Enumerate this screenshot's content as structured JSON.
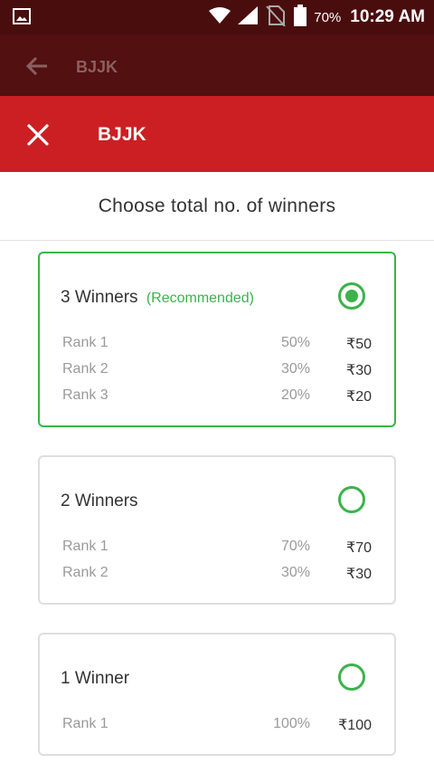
{
  "status_bar": {
    "battery_pct": "70%",
    "time": "10:29 AM",
    "icons": [
      "image-icon",
      "wifi-icon",
      "cell-signal-icon",
      "no-sim-icon",
      "battery-icon"
    ]
  },
  "app_bar": {
    "title": "BJJK"
  },
  "modal": {
    "title": "BJJK",
    "heading": "Choose total no. of winners"
  },
  "options": [
    {
      "title": "3 Winners",
      "tag": "(Recommended)",
      "selected": true,
      "ranks": [
        {
          "label": "Rank 1",
          "pct": "50%",
          "amount": "₹50"
        },
        {
          "label": "Rank 2",
          "pct": "30%",
          "amount": "₹30"
        },
        {
          "label": "Rank 3",
          "pct": "20%",
          "amount": "₹20"
        }
      ]
    },
    {
      "title": "2 Winners",
      "selected": false,
      "ranks": [
        {
          "label": "Rank 1",
          "pct": "70%",
          "amount": "₹70"
        },
        {
          "label": "Rank 2",
          "pct": "30%",
          "amount": "₹30"
        }
      ]
    },
    {
      "title": "1 Winner",
      "selected": false,
      "ranks": [
        {
          "label": "Rank 1",
          "pct": "100%",
          "amount": "₹100"
        }
      ]
    }
  ],
  "colors": {
    "status_bar": "#4a0d0e",
    "header_red": "#cc1f24",
    "accent_green": "#3bb34a"
  }
}
